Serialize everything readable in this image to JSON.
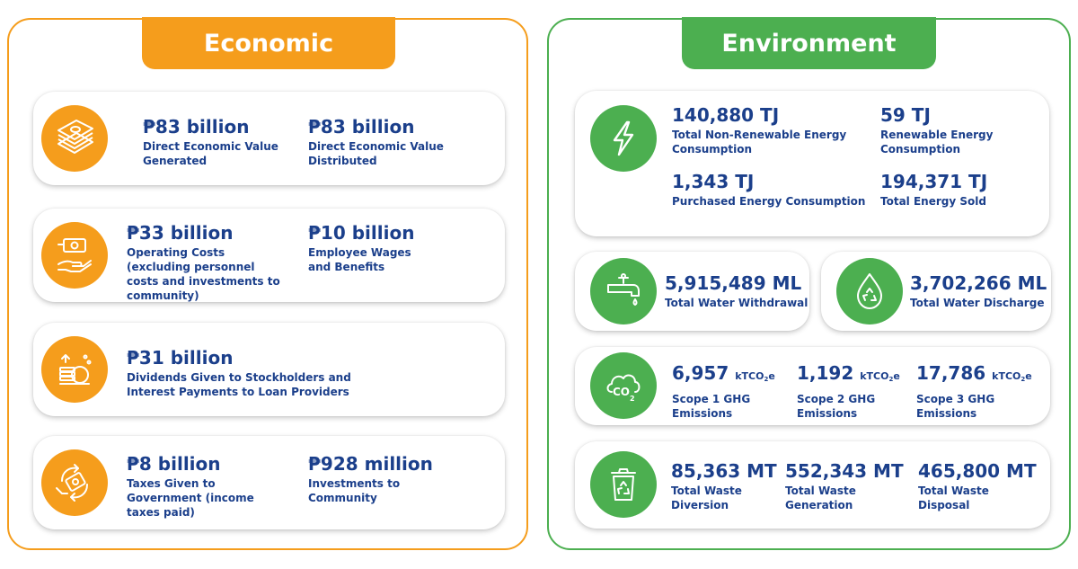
{
  "economic": {
    "title": "Economic",
    "cards": [
      {
        "icon": "money-stack-icon",
        "metrics": [
          {
            "value": "₱83 billion",
            "label": "Direct Economic Value Generated"
          },
          {
            "value": "₱83 billion",
            "label": "Direct Economic Value Distributed"
          }
        ]
      },
      {
        "icon": "hand-cash-icon",
        "metrics": [
          {
            "value": "₱33 billion",
            "label": "Operating Costs (excluding personnel costs and investments to community)"
          },
          {
            "value": "₱10 billion",
            "label": "Employee Wages and Benefits"
          }
        ]
      },
      {
        "icon": "coins-growth-icon",
        "metrics": [
          {
            "value": "₱31 billion",
            "label": "Dividends Given to Stockholders and Interest Payments to Loan Providers"
          }
        ]
      },
      {
        "icon": "money-exchange-icon",
        "metrics": [
          {
            "value": "₱8 billion",
            "label": "Taxes Given to Government (income taxes paid)"
          },
          {
            "value": "₱928 million",
            "label": "Investments to Community"
          }
        ]
      }
    ]
  },
  "environment": {
    "title": "Environment",
    "energy": {
      "icon": "lightning-bolt-icon",
      "metrics": [
        {
          "value": "140,880 TJ",
          "label": "Total Non-Renewable Energy Consumption"
        },
        {
          "value": "59 TJ",
          "label": "Renewable Energy Consumption"
        },
        {
          "value": "1,343 TJ",
          "label": "Purchased Energy Consumption"
        },
        {
          "value": "194,371 TJ",
          "label": "Total Energy Sold"
        }
      ]
    },
    "water_withdrawal": {
      "icon": "water-tap-icon",
      "value": "5,915,489 ML",
      "label": "Total Water Withdrawal"
    },
    "water_discharge": {
      "icon": "water-recycle-drop-icon",
      "value": "3,702,266 ML",
      "label": "Total Water Discharge"
    },
    "emissions": {
      "icon": "co2-cloud-icon",
      "unit": "kTCO",
      "unit_sub": "2",
      "unit_suffix": "e",
      "metrics": [
        {
          "value": "6,957",
          "label": "Scope 1 GHG Emissions"
        },
        {
          "value": "1,192",
          "label": "Scope 2 GHG Emissions"
        },
        {
          "value": "17,786",
          "label": "Scope 3 GHG Emissions"
        }
      ]
    },
    "waste": {
      "icon": "recycle-bin-icon",
      "metrics": [
        {
          "value": "85,363 MT",
          "label": "Total Waste Diversion"
        },
        {
          "value": "552,343 MT",
          "label": "Total Waste Generation"
        },
        {
          "value": "465,800 MT",
          "label": "Total Waste Disposal"
        }
      ]
    }
  }
}
